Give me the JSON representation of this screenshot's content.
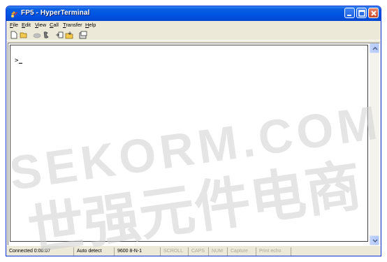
{
  "window": {
    "title": "FP5 - HyperTerminal",
    "app_icon": "hyperterminal-phone-icon",
    "controls": {
      "minimize": "minimize-icon",
      "maximize": "maximize-icon",
      "close": "close-icon"
    }
  },
  "menu": {
    "items": [
      {
        "label_u": "F",
        "label_rest": "ile"
      },
      {
        "label_u": "E",
        "label_rest": "dit"
      },
      {
        "label_u": "V",
        "label_rest": "iew"
      },
      {
        "label_u": "C",
        "label_rest": "all"
      },
      {
        "label_u": "T",
        "label_rest": "ransfer"
      },
      {
        "label_u": "H",
        "label_rest": "elp"
      }
    ]
  },
  "toolbar": {
    "icons": [
      "new-icon",
      "open-icon",
      "connect-icon",
      "disconnect-icon",
      "send-icon",
      "receive-icon",
      "properties-icon"
    ]
  },
  "terminal": {
    "prompt": ">",
    "cursor": "_"
  },
  "status": {
    "connected": "Connected 0:00:07",
    "detect": "Auto detect",
    "settings": "9600 8-N-1",
    "scroll": "SCROLL",
    "caps": "CAPS",
    "num": "NUM",
    "capture": "Capture",
    "print_echo": "Print echo"
  },
  "watermark": {
    "line1": "SEKORM.COM",
    "line2": "世强元件电商"
  },
  "colors": {
    "titlebar": "#0054e3",
    "frame": "#ece9d8",
    "watermark": "#d9d9d9"
  }
}
